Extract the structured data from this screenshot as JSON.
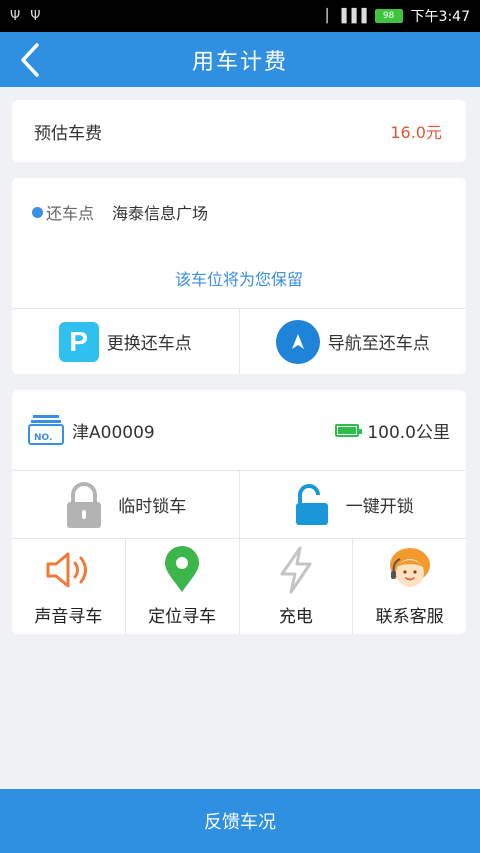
{
  "status_bar": {
    "usb1": "Ψ",
    "usb2": "Ψ",
    "signal": "▏▐▐▐",
    "battery": "98",
    "time": "下午3:47"
  },
  "header": {
    "title": "用车计费"
  },
  "fee": {
    "label": "预估车费",
    "value": "16.0元"
  },
  "return_point": {
    "label": "还车点",
    "place": "海泰信息广场",
    "reserve_note": "该车位将为您保留",
    "change_label": "更换还车点",
    "navigate_label": "导航至还车点"
  },
  "car": {
    "plate_badge": "NO.",
    "plate": "津A00009",
    "range": "100.0公里",
    "temp_lock": "临时锁车",
    "unlock": "一键开锁",
    "tools": [
      {
        "label": "声音寻车",
        "icon": "speaker-icon"
      },
      {
        "label": "定位寻车",
        "icon": "location-pin-icon"
      },
      {
        "label": "充电",
        "icon": "lightning-icon"
      },
      {
        "label": "联系客服",
        "icon": "service-agent-icon"
      }
    ]
  },
  "feedback_button": "反馈车况",
  "colors": {
    "primary": "#2f8fe0",
    "fee": "#e0553a",
    "accent_blue": "#3a8fe6",
    "location_green": "#3cb54a",
    "speaker_orange": "#f07a3a",
    "unlock_blue": "#1a97d8"
  }
}
